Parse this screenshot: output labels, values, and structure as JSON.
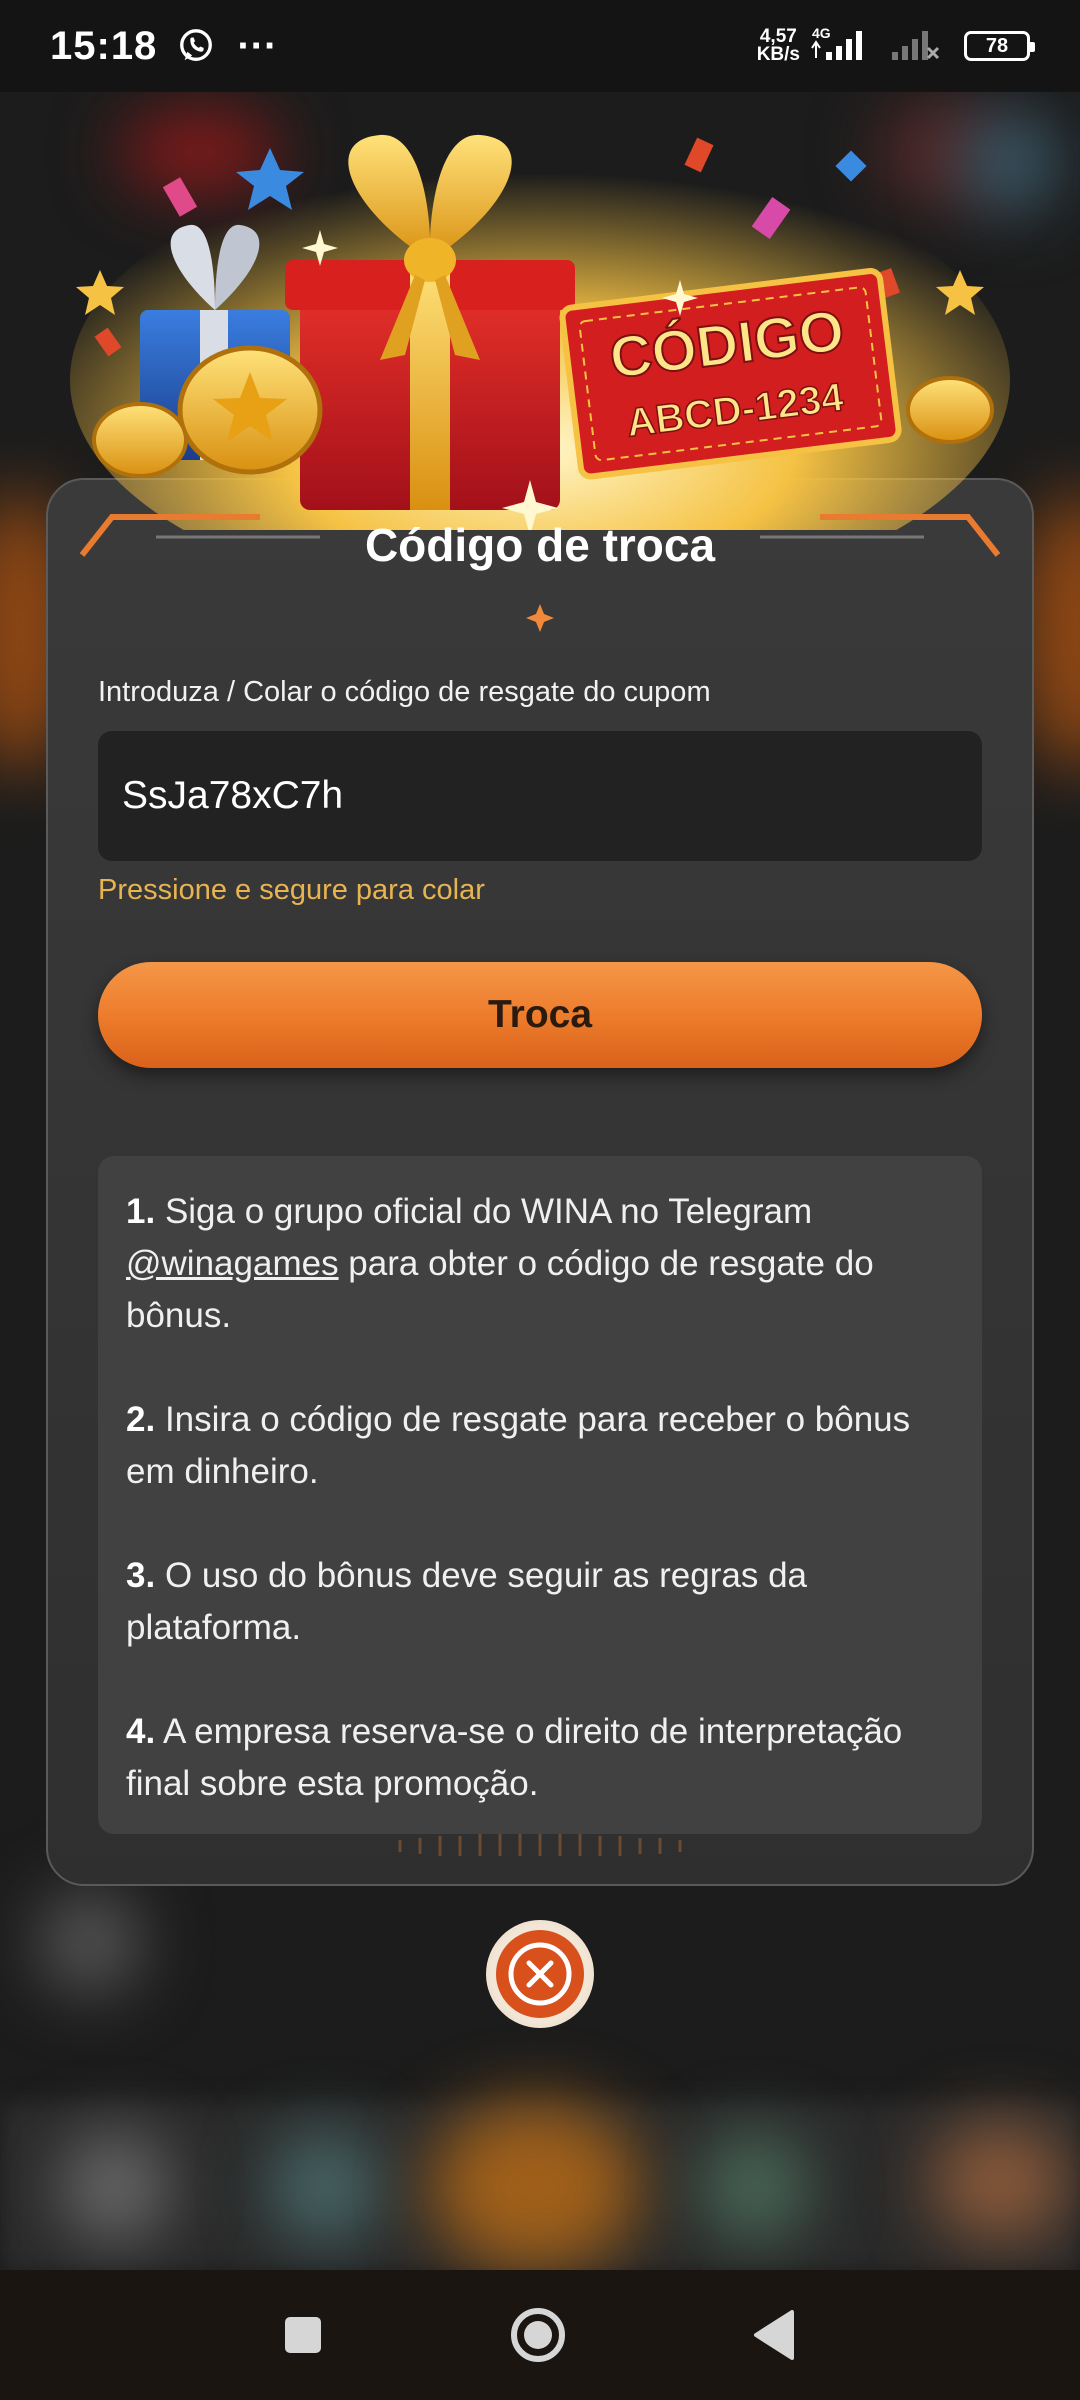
{
  "status_bar": {
    "time": "15:18",
    "net_speed_value": "4,57",
    "net_speed_unit": "KB/s",
    "network_type": "4G",
    "battery": "78"
  },
  "banner": {
    "code_word": "CÓDIGO",
    "code_sample": "ABCD-1234"
  },
  "modal": {
    "title": "Código de troca",
    "input_label": "Introduza / Colar o código de resgate do cupom",
    "input_value": "SsJa78xC7h",
    "paste_hint": "Pressione e segure para colar",
    "submit_label": "Troca",
    "rules": [
      {
        "num": "1.",
        "text_before": "Siga o grupo oficial do WINA no Telegram ",
        "link": "@winagames",
        "text_after": " para obter o código de resgate do bônus."
      },
      {
        "num": "2.",
        "text": "Insira o código de resgate para receber o bônus em dinheiro."
      },
      {
        "num": "3.",
        "text": "O uso do bônus deve seguir as regras da plataforma."
      },
      {
        "num": "4.",
        "text": "A empresa reserva-se o direito de interpretação final sobre esta promoção."
      }
    ]
  },
  "colors": {
    "accent": "#ec7a2a",
    "hint": "#e8b451",
    "modal_bg": "#363636",
    "close_icon": "#d8501c"
  },
  "icons": {
    "status": [
      "whatsapp-icon",
      "signal-icon",
      "battery-icon"
    ],
    "close": "close-circle-icon",
    "nav": [
      "recents-square-icon",
      "home-circle-icon",
      "back-triangle-icon"
    ]
  }
}
